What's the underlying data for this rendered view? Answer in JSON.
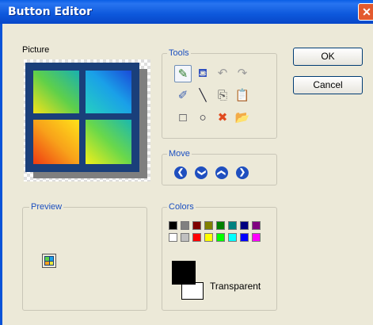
{
  "window": {
    "title": "Button Editor",
    "close_symbol": "✕"
  },
  "picture": {
    "label": "Picture"
  },
  "tools": {
    "label": "Tools",
    "items": [
      {
        "name": "pencil-tool",
        "glyph": "✎",
        "color": "#2a7a2a"
      },
      {
        "name": "fill-tool",
        "glyph": "⛾",
        "color": "#2f4fbf"
      },
      {
        "name": "undo-tool",
        "glyph": "↶",
        "color": "#9a9a9a"
      },
      {
        "name": "redo-tool",
        "glyph": "↷",
        "color": "#9a9a9a"
      },
      {
        "name": "eraser-tool",
        "glyph": "✐",
        "color": "#3b5fb0"
      },
      {
        "name": "line-tool",
        "glyph": "╲",
        "color": "#223"
      },
      {
        "name": "copy-tool",
        "glyph": "⎘",
        "color": "#555"
      },
      {
        "name": "paste-tool",
        "glyph": "📋",
        "color": "#b58a2a"
      },
      {
        "name": "rectangle-tool",
        "glyph": "□",
        "color": "#223"
      },
      {
        "name": "ellipse-tool",
        "glyph": "○",
        "color": "#223"
      },
      {
        "name": "clear-tool",
        "glyph": "✖",
        "color": "#e04a1e"
      },
      {
        "name": "open-tool",
        "glyph": "📂",
        "color": "#c89a2a"
      }
    ]
  },
  "buttons": {
    "ok": "OK",
    "cancel": "Cancel"
  },
  "move": {
    "label": "Move",
    "directions": [
      "left",
      "down",
      "up",
      "right"
    ],
    "glyphs": [
      "❮",
      "❯",
      "❯",
      "❯"
    ]
  },
  "preview": {
    "label": "Preview"
  },
  "colors": {
    "label": "Colors",
    "palette_row1": [
      "#000000",
      "#808080",
      "#800000",
      "#808000",
      "#008000",
      "#008080",
      "#000080",
      "#800080"
    ],
    "palette_row2": [
      "#ffffff",
      "#c0c0c0",
      "#ff0000",
      "#ffff00",
      "#00ff00",
      "#00ffff",
      "#0000ff",
      "#ff00ff"
    ],
    "foreground": "#000000",
    "background": "#ffffff",
    "transparent_label": "Transparent"
  }
}
